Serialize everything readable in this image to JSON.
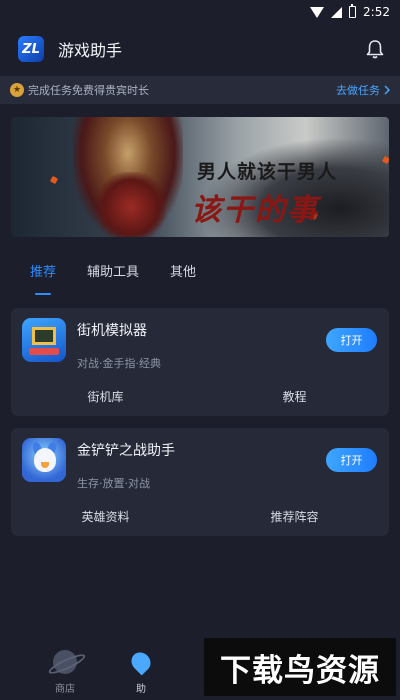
{
  "status_bar": {
    "time": "2:52"
  },
  "app_bar": {
    "logo_text": "ZL",
    "title": "游戏助手",
    "bell_icon": "bell-icon"
  },
  "task_bar": {
    "text": "完成任务免费得贵宾时长",
    "link_label": "去做任务",
    "link_icon": "chevron-right-icon"
  },
  "banner": {
    "line1": "男人就该干男人",
    "line2": "该干的事"
  },
  "tabs": [
    {
      "label": "推荐",
      "active": true
    },
    {
      "label": "辅助工具",
      "active": false
    },
    {
      "label": "其他",
      "active": false
    }
  ],
  "cards": [
    {
      "title": "街机模拟器",
      "tags": "对战·金手指·经典",
      "button": "打开",
      "actions": [
        "街机库",
        "教程"
      ],
      "icon": "arcade-machine-icon"
    },
    {
      "title": "金铲铲之战助手",
      "tags": "生存·放置·对战",
      "button": "打开",
      "actions": [
        "英雄资料",
        "推荐阵容"
      ],
      "icon": "penguin-icon"
    }
  ],
  "bottom_nav": [
    {
      "label": "商店",
      "icon": "planet-icon"
    },
    {
      "label": "助",
      "icon": "drop-icon"
    }
  ],
  "watermark": "下载鸟资源",
  "colors": {
    "accent": "#2e8dff",
    "background": "#1c1f2b",
    "card": "#262a38"
  }
}
